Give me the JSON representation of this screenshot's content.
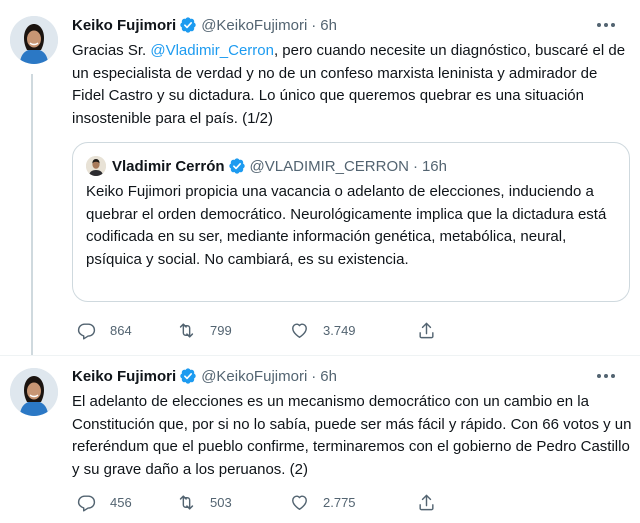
{
  "tweets": [
    {
      "author": {
        "name": "Keiko Fujimori",
        "handle": "@KeikoFujimori",
        "time": "6h"
      },
      "text_before_mention": "Gracias Sr. ",
      "mention": "@Vladimir_Cerron",
      "text_after_mention": ", pero cuando necesite un diagnóstico, buscaré el de un especialista de verdad y no de un confeso marxista leninista y admirador de Fidel Castro y su dictadura. Lo único que queremos quebrar es una situación insostenible para el país. (1/2)",
      "quote": {
        "author": {
          "name": "Vladimir Cerrón",
          "handle": "@VLADIMIR_CERRON",
          "time": "16h"
        },
        "text": "Keiko Fujimori propicia una vacancia o adelanto de elecciones, induciendo a quebrar el orden democrático. Neurológicamente implica que la dictadura está codificada en su ser, mediante información genética, metabólica, neural, psíquica y social. No cambiará, es su existencia."
      },
      "stats": {
        "replies": "864",
        "retweets": "799",
        "likes": "3.749"
      }
    },
    {
      "author": {
        "name": "Keiko Fujimori",
        "handle": "@KeikoFujimori",
        "time": "6h"
      },
      "text": "El adelanto de elecciones es un mecanismo democrático con un cambio en la Constitución que, por si no lo sabía, puede ser más fácil y rápido. Con 66 votos y un referéndum que el pueblo confirme, terminaremos con el gobierno de Pedro Castillo y su grave daño a los peruanos. (2)",
      "stats": {
        "replies": "456",
        "retweets": "503",
        "likes": "2.775"
      }
    }
  ],
  "separator": "·",
  "colors": {
    "accent": "#1d9bf0",
    "text": "#0f1419",
    "muted": "#536471",
    "border": "#cfd9de"
  },
  "icons": {
    "verified": "verified-badge-icon",
    "more": "more-options-icon",
    "reply": "reply-icon",
    "retweet": "retweet-icon",
    "like": "heart-icon",
    "share": "share-icon"
  }
}
